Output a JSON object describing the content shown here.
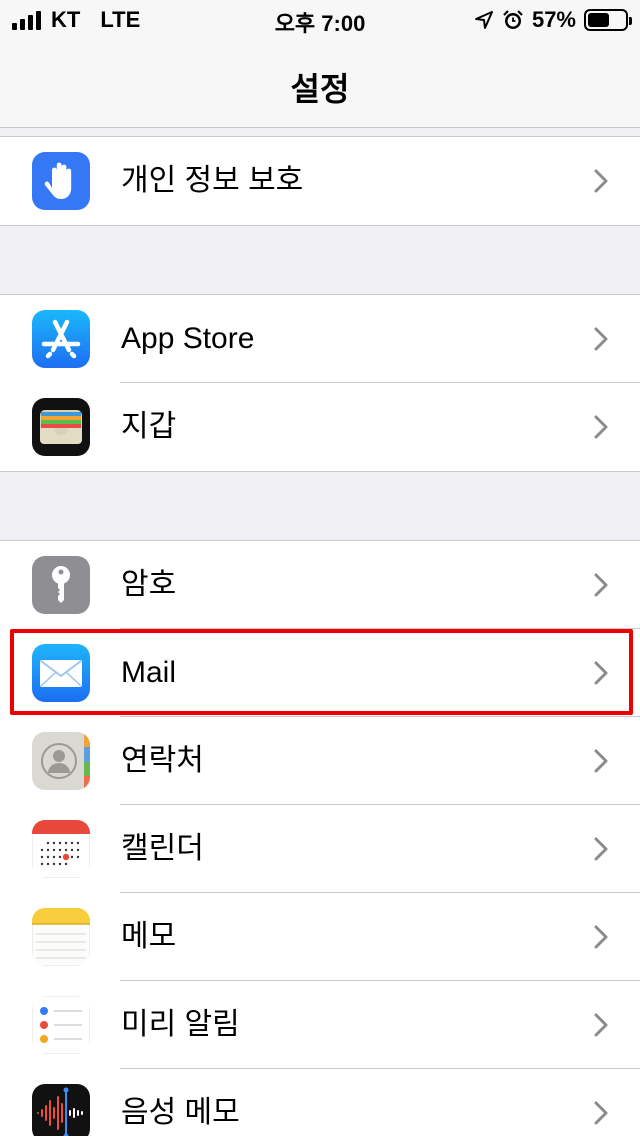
{
  "status_bar": {
    "carrier": "KT",
    "network": "LTE",
    "time": "오후 7:00",
    "battery": "57%",
    "battery_level": 0.57
  },
  "nav": {
    "title": "설정"
  },
  "rows": {
    "privacy": {
      "label": "개인 정보 보호",
      "icon": "hand-icon"
    },
    "appstore": {
      "label": "App Store",
      "icon": "app-store-icon"
    },
    "wallet": {
      "label": "지갑",
      "icon": "wallet-icon"
    },
    "passwords": {
      "label": "암호",
      "icon": "key-icon"
    },
    "mail": {
      "label": "Mail",
      "icon": "mail-icon"
    },
    "contacts": {
      "label": "연락처",
      "icon": "contacts-icon"
    },
    "calendar": {
      "label": "캘린더",
      "icon": "calendar-icon"
    },
    "notes": {
      "label": "메모",
      "icon": "notes-icon"
    },
    "reminders": {
      "label": "미리 알림",
      "icon": "reminders-icon"
    },
    "voicememos": {
      "label": "음성 메모",
      "icon": "voice-memos-icon"
    }
  },
  "colors": {
    "highlight": "#ee0000",
    "privacy_blue": "#3478f6",
    "appstore_blue": "#1c8cf7",
    "key_gray": "#8e8e93",
    "mail_blue": "#2e8cf3"
  }
}
